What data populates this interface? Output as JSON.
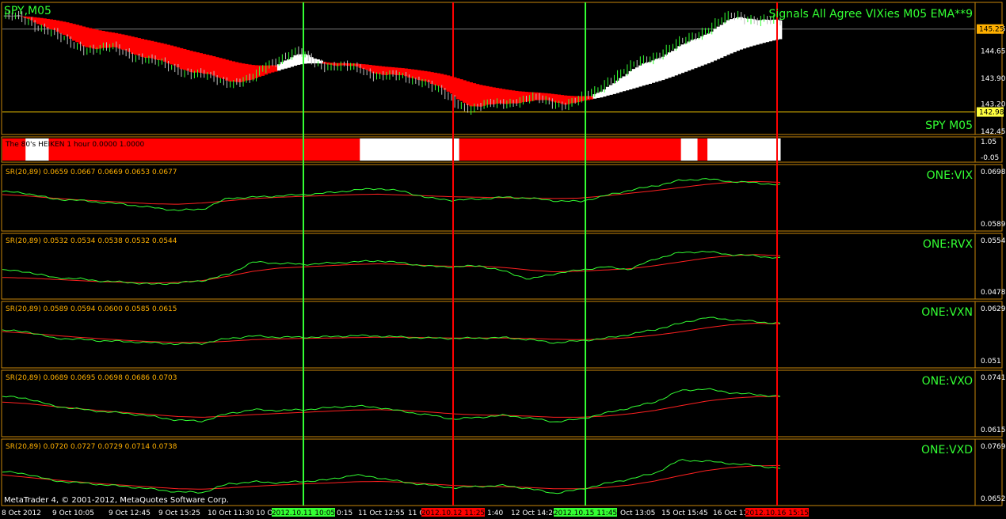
{
  "header": {
    "title": "Signals All Agree VIXies M05 EMA**9",
    "symbol_top": "SPY,M05",
    "symbol_bottom": "SPY M05"
  },
  "footer": {
    "copyright": "MetaTrader 4, © 2001-2012, MetaQuotes Software Corp."
  },
  "colors": {
    "background": "#000000",
    "grid": "#c7860a",
    "bull": "#33ff33",
    "bear": "#ff0000",
    "ribbon_down": "#ff0000",
    "ribbon_up": "#ffffff",
    "sr": "#33ff33",
    "ema": "#ff2020"
  },
  "chart_data": {
    "type": "line",
    "time_axis": {
      "labels": [
        "8 Oct 2012",
        "9 Oct 10:05",
        "9 Oct 12:45",
        "9 Oct 15:25",
        "10 Oct 11:30",
        "10 O",
        "0:15",
        "11 Oct 12:55",
        "11 O",
        "1:40",
        "12 Oct 14:20",
        "Oct 13:05",
        "15 Oct 15:45",
        "16 Oct 11:"
      ],
      "signal_tags": [
        {
          "label": "2012.10.11 10:05",
          "kind": "buy"
        },
        {
          "label": "2012.10.12 11:25",
          "kind": "sell"
        },
        {
          "label": "2012.10.15 11:45",
          "kind": "buy"
        },
        {
          "label": "2012.10.16 15:15",
          "kind": "sell"
        }
      ]
    },
    "price_panel": {
      "symbol": "SPY M05",
      "ticks": [
        "145.25",
        "144.65",
        "143.90",
        "143.20",
        "142.45"
      ],
      "hlines": [
        {
          "value": 145.25,
          "label": "145.25"
        },
        {
          "value": 142.98,
          "label": "142.98"
        }
      ],
      "ylim": [
        142.45,
        145.85
      ],
      "close_path": [
        145.6,
        145.55,
        145.4,
        145.2,
        144.9,
        144.75,
        144.7,
        144.72,
        144.6,
        144.45,
        144.3,
        144.2,
        144.05,
        143.95,
        143.85,
        143.8,
        143.85,
        144.3,
        144.5,
        144.6,
        144.35,
        144.25,
        144.2,
        144.15,
        144.0,
        143.95,
        143.9,
        143.85,
        143.55,
        143.25,
        143.1,
        143.15,
        143.2,
        143.3,
        143.35,
        143.25,
        143.2,
        143.3,
        143.5,
        143.9,
        144.1,
        144.35,
        144.55,
        144.75,
        144.95,
        145.2,
        145.45,
        145.6,
        145.55,
        145.5,
        145.4
      ]
    },
    "heiken_panel": {
      "label": "The 80's HEIKEN 1 hour 0.0000 1.0000",
      "ticks": [
        "1.05",
        "-0.05"
      ],
      "segments": [
        {
          "state": "down",
          "weight": 7
        },
        {
          "state": "up",
          "weight": 7
        },
        {
          "state": "down",
          "weight": 94
        },
        {
          "state": "up",
          "weight": 30
        },
        {
          "state": "down",
          "weight": 67
        },
        {
          "state": "up",
          "weight": 5
        },
        {
          "state": "down",
          "weight": 3
        },
        {
          "state": "up",
          "weight": 22
        }
      ]
    },
    "indicators": [
      {
        "name": "ONE:VIX",
        "label": "SR(20,89) 0.0659 0.0667 0.0669 0.0653 0.0677",
        "ticks": [
          "0.0698",
          "0.0589"
        ],
        "sr": [
          0.0665,
          0.0661,
          0.0648,
          0.0645,
          0.064,
          0.0635,
          0.0628,
          0.0622,
          0.0625,
          0.065,
          0.0652,
          0.0655,
          0.0658,
          0.0662,
          0.0668,
          0.0672,
          0.0665,
          0.065,
          0.0645,
          0.0648,
          0.0652,
          0.065,
          0.0644,
          0.0642,
          0.0655,
          0.0668,
          0.0678,
          0.069,
          0.0694,
          0.0688,
          0.0685,
          0.068
        ],
        "ema": [
          0.0658,
          0.0655,
          0.065,
          0.0646,
          0.0643,
          0.064,
          0.0637,
          0.0636,
          0.0639,
          0.0644,
          0.0649,
          0.0652,
          0.0654,
          0.0656,
          0.0658,
          0.0659,
          0.0657,
          0.0655,
          0.0653,
          0.0652,
          0.0651,
          0.065,
          0.0649,
          0.065,
          0.0655,
          0.0661,
          0.0667,
          0.0674,
          0.0681,
          0.0686,
          0.0688,
          0.0686
        ]
      },
      {
        "name": "ONE:RVX",
        "label": "SR(20,89) 0.0532 0.0534 0.0538 0.0532 0.0544",
        "ticks": [
          "0.0554",
          "0.0478"
        ],
        "sr": [
          0.0515,
          0.0512,
          0.0503,
          0.0501,
          0.0497,
          0.0495,
          0.0492,
          0.0494,
          0.0498,
          0.0508,
          0.0528,
          0.0526,
          0.0524,
          0.0526,
          0.0528,
          0.053,
          0.0526,
          0.0521,
          0.052,
          0.0522,
          0.0513,
          0.05,
          0.0509,
          0.0515,
          0.052,
          0.0516,
          0.0533,
          0.0543,
          0.0545,
          0.054,
          0.0538,
          0.0534
        ],
        "ema": [
          0.0503,
          0.0502,
          0.05,
          0.0498,
          0.0496,
          0.0495,
          0.0494,
          0.0495,
          0.0498,
          0.0505,
          0.0513,
          0.0518,
          0.052,
          0.0522,
          0.0524,
          0.0525,
          0.0524,
          0.0522,
          0.0521,
          0.0521,
          0.0519,
          0.0515,
          0.0512,
          0.0513,
          0.0515,
          0.0517,
          0.0522,
          0.0528,
          0.0534,
          0.0538,
          0.054,
          0.0538
        ]
      },
      {
        "name": "ONE:VXN",
        "label": "SR(20,89) 0.0589 0.0594 0.0600 0.0585 0.0615",
        "ticks": [
          "0.0629",
          "0.051"
        ],
        "sr": [
          0.0588,
          0.0585,
          0.0569,
          0.0566,
          0.0562,
          0.056,
          0.0557,
          0.0554,
          0.0556,
          0.0568,
          0.0574,
          0.0571,
          0.0571,
          0.0572,
          0.0575,
          0.0574,
          0.0571,
          0.0569,
          0.0568,
          0.0569,
          0.057,
          0.0565,
          0.0557,
          0.0562,
          0.0568,
          0.0578,
          0.059,
          0.0605,
          0.062,
          0.0615,
          0.061,
          0.0605
        ],
        "ema": [
          0.0585,
          0.0581,
          0.0576,
          0.0571,
          0.0567,
          0.0563,
          0.056,
          0.0558,
          0.0558,
          0.0561,
          0.0565,
          0.0567,
          0.0568,
          0.0569,
          0.057,
          0.0571,
          0.0571,
          0.057,
          0.0569,
          0.0569,
          0.0569,
          0.0568,
          0.0566,
          0.0565,
          0.0566,
          0.057,
          0.0576,
          0.0584,
          0.0594,
          0.0602,
          0.0606,
          0.0604
        ]
      },
      {
        "name": "ONE:VXO",
        "label": "SR(20,89) 0.0689 0.0695 0.0698 0.0686 0.0703",
        "ticks": [
          "0.0741",
          "0.0615"
        ],
        "sr": [
          0.0705,
          0.07,
          0.068,
          0.0672,
          0.0665,
          0.066,
          0.0652,
          0.0642,
          0.064,
          0.066,
          0.067,
          0.0668,
          0.067,
          0.0675,
          0.068,
          0.0676,
          0.0665,
          0.0656,
          0.0645,
          0.065,
          0.0655,
          0.0648,
          0.0638,
          0.0645,
          0.066,
          0.0675,
          0.069,
          0.072,
          0.0725,
          0.0715,
          0.071,
          0.0705
        ],
        "ema": [
          0.069,
          0.0686,
          0.0679,
          0.0673,
          0.0667,
          0.0662,
          0.0657,
          0.0652,
          0.065,
          0.0653,
          0.0657,
          0.066,
          0.0663,
          0.0666,
          0.0669,
          0.067,
          0.0668,
          0.0664,
          0.0659,
          0.0656,
          0.0655,
          0.0653,
          0.065,
          0.065,
          0.0653,
          0.0659,
          0.0668,
          0.068,
          0.0692,
          0.07,
          0.0704,
          0.0705
        ]
      },
      {
        "name": "ONE:VXD",
        "label": "SR(20,89) 0.0720 0.0727 0.0729 0.0714 0.0738",
        "ticks": [
          "0.0769",
          "0.0652"
        ],
        "sr": [
          0.072,
          0.0714,
          0.0698,
          0.0693,
          0.0688,
          0.0683,
          0.0677,
          0.067,
          0.0669,
          0.069,
          0.0695,
          0.0693,
          0.0696,
          0.07,
          0.0712,
          0.0705,
          0.0694,
          0.0687,
          0.068,
          0.0684,
          0.0686,
          0.0678,
          0.0667,
          0.0676,
          0.069,
          0.0702,
          0.0716,
          0.0748,
          0.0746,
          0.074,
          0.0735,
          0.0728
        ],
        "ema": [
          0.0712,
          0.0706,
          0.07,
          0.0695,
          0.069,
          0.0686,
          0.0682,
          0.0678,
          0.0677,
          0.068,
          0.0684,
          0.0687,
          0.069,
          0.0692,
          0.0695,
          0.0696,
          0.0694,
          0.069,
          0.0686,
          0.0684,
          0.0683,
          0.0681,
          0.0678,
          0.0678,
          0.0681,
          0.0687,
          0.0697,
          0.071,
          0.0722,
          0.073,
          0.0734,
          0.0735
        ]
      }
    ]
  }
}
